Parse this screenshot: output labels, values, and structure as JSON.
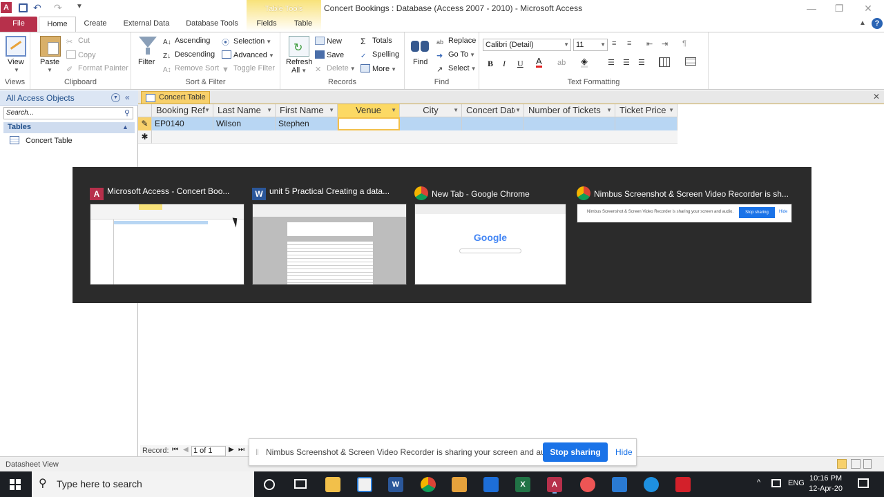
{
  "window": {
    "title": "Concert Bookings : Database (Access 2007 - 2010)  -  Microsoft Access",
    "context_group": "Table Tools"
  },
  "tabs": [
    "File",
    "Home",
    "Create",
    "External Data",
    "Database Tools",
    "Fields",
    "Table"
  ],
  "ribbon": {
    "views": {
      "view": "View",
      "label": "Views"
    },
    "clipboard": {
      "paste": "Paste",
      "cut": "Cut",
      "copy": "Copy",
      "format_painter": "Format Painter",
      "label": "Clipboard"
    },
    "sort_filter": {
      "filter": "Filter",
      "ascending": "Ascending",
      "descending": "Descending",
      "remove_sort": "Remove Sort",
      "selection": "Selection",
      "advanced": "Advanced",
      "toggle_filter": "Toggle Filter",
      "label": "Sort & Filter"
    },
    "records": {
      "refresh": "Refresh",
      "refresh2": "All",
      "new": "New",
      "save": "Save",
      "delete": "Delete",
      "totals": "Totals",
      "spelling": "Spelling",
      "more": "More",
      "label": "Records"
    },
    "find": {
      "find": "Find",
      "replace": "Replace",
      "goto": "Go To",
      "select": "Select",
      "label": "Find"
    },
    "text_formatting": {
      "font": "Calibri (Detail)",
      "size": "11",
      "bold": "B",
      "italic": "I",
      "underline": "U",
      "label": "Text Formatting"
    }
  },
  "nav": {
    "header": "All Access Objects",
    "search_placeholder": "Search...",
    "group": "Tables",
    "items": [
      "Concert Table"
    ]
  },
  "doc": {
    "tab": "Concert Table",
    "columns": [
      "Booking Ref",
      "Last Name",
      "First Name",
      "Venue",
      "City",
      "Concert Date",
      "Number of Tickets",
      "Ticket Price"
    ],
    "rows": [
      [
        "EP0140",
        "Wilson",
        "Stephen",
        "",
        "",
        "",
        "",
        ""
      ]
    ]
  },
  "switcher": {
    "windows": [
      {
        "title": "Microsoft Access - Concert Boo..."
      },
      {
        "title": "unit 5 Practical  Creating a data..."
      },
      {
        "title": "New Tab - Google Chrome"
      },
      {
        "title": "Nimbus Screenshot & Screen Video Recorder is sh..."
      }
    ],
    "google_logo": "Google",
    "nimbus_thumb_text": "Nimbus Screenshot & Screen Video Recorder is sharing your screen and audio.",
    "nimbus_thumb_stop": "Stop sharing",
    "nimbus_thumb_hide": "Hide"
  },
  "record_nav": {
    "label": "Record:",
    "value": "1 of 1"
  },
  "status": {
    "left": "Datasheet View"
  },
  "share_bar": {
    "message": "Nimbus Screenshot & Screen Video Recorder is sharing your screen and audio.",
    "stop": "Stop sharing",
    "hide": "Hide"
  },
  "taskbar": {
    "search_placeholder": "Type here to search",
    "lang": "ENG",
    "time": "10:16 PM",
    "date": "12-Apr-20"
  },
  "colors": {
    "file_tab": "#b7304b",
    "table_tools": "#f8e27a",
    "selected_col": "#fcd964",
    "row_select": "#b8d6f3",
    "switcher_bg": "#2b2b2b",
    "stop_btn": "#1a73e8"
  }
}
